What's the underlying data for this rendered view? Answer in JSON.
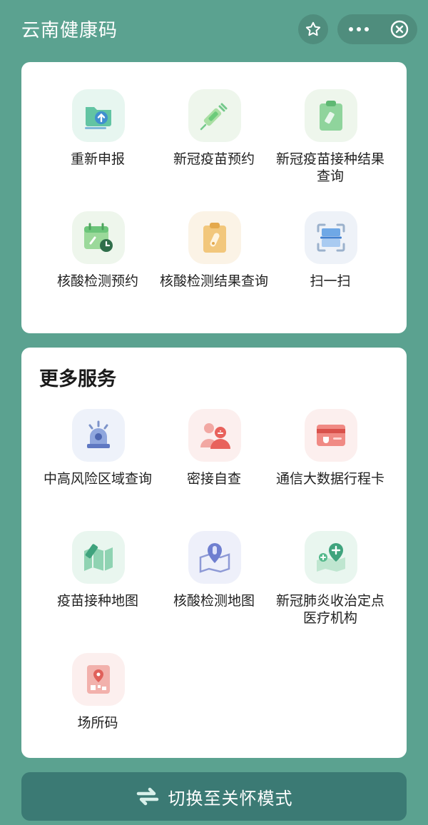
{
  "header": {
    "title": "云南健康码",
    "favorite_icon": "star-icon",
    "more_icon": "more-dots-icon",
    "close_icon": "close-circle-icon"
  },
  "main_services": [
    {
      "label": "重新申报",
      "icon": "folder-upload-icon"
    },
    {
      "label": "新冠疫苗预约",
      "icon": "syringe-icon"
    },
    {
      "label": "新冠疫苗接种结果查询",
      "icon": "clipboard-vaccine-icon"
    },
    {
      "label": "核酸检测预约",
      "icon": "calendar-clock-icon"
    },
    {
      "label": "核酸检测结果查询",
      "icon": "clipboard-testtube-icon"
    },
    {
      "label": "扫一扫",
      "icon": "scan-icon"
    }
  ],
  "more_services": {
    "title": "更多服务",
    "items": [
      {
        "label": "中高风险区域查询",
        "icon": "alarm-light-icon"
      },
      {
        "label": "密接自查",
        "icon": "contacts-icon"
      },
      {
        "label": "通信大数据行程卡",
        "icon": "travel-card-icon"
      },
      {
        "label": "疫苗接种地图",
        "icon": "vaccine-map-icon"
      },
      {
        "label": "核酸检测地图",
        "icon": "test-map-icon"
      },
      {
        "label": "新冠肺炎收治定点医疗机构",
        "icon": "hospital-map-icon"
      },
      {
        "label": "场所码",
        "icon": "venue-code-icon"
      }
    ]
  },
  "mode_switch": {
    "label": "切换至关怀模式",
    "icon": "switch-arrows-icon"
  },
  "colors": {
    "background": "#5ba290",
    "card": "#ffffff",
    "mode_button": "#3b7a74"
  }
}
